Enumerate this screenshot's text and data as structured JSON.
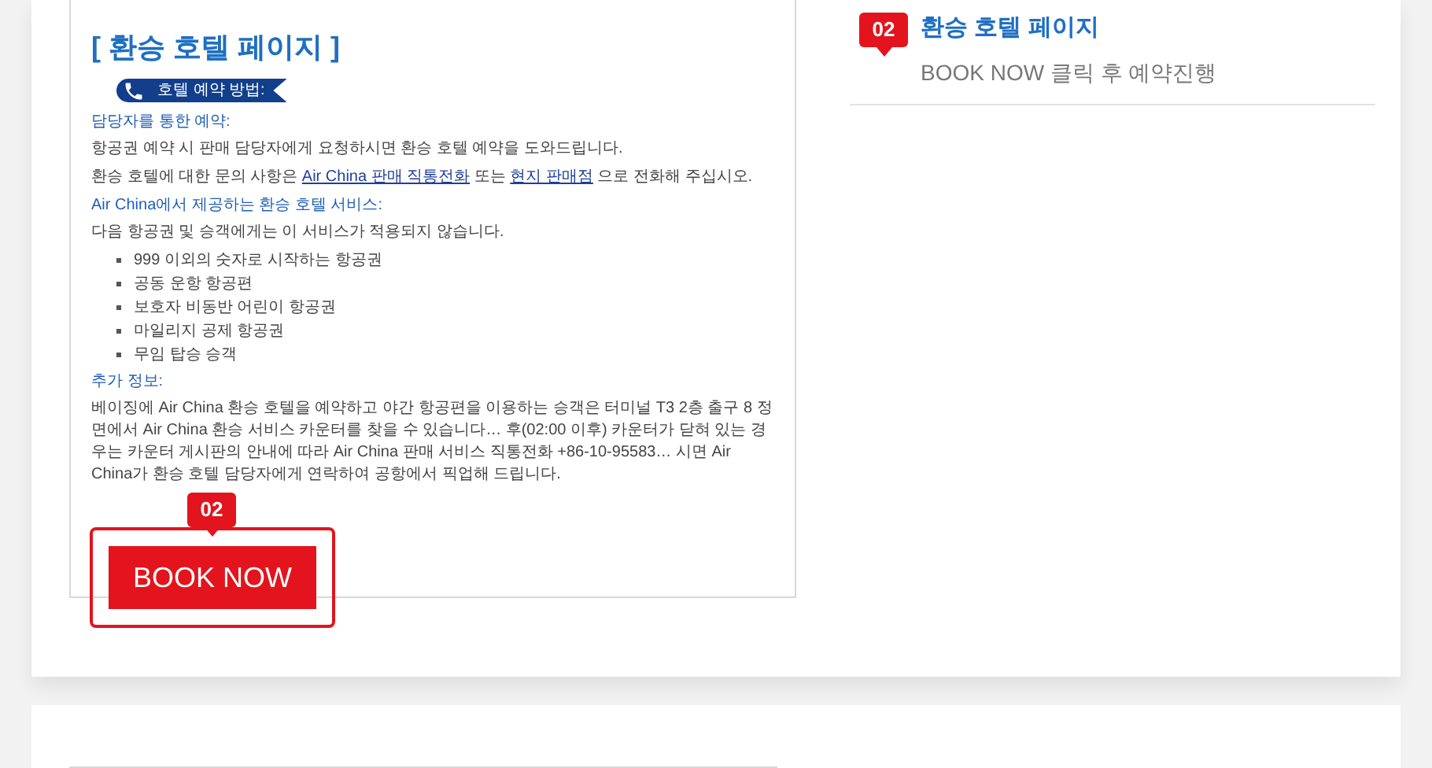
{
  "guide_card": {
    "heading": "[ 환승 호텔 페이지 ]",
    "ribbon": "호텔 예약 방법:",
    "blocks": [
      {
        "kind": "label",
        "text": "담당자를 통한 예약:"
      },
      {
        "kind": "paragraph",
        "parts": [
          {
            "text": "항공권 예약 시 판매 담당자에게 요청하시면 환승 호텔 예약을 도와드립니다.",
            "link": false
          }
        ]
      },
      {
        "kind": "paragraph",
        "parts": [
          {
            "text": "환승 호텔에 대한 문의 사항은 ",
            "link": false
          },
          {
            "text": "Air China 판매 직통전화",
            "link": true
          },
          {
            "text": " 또는 ",
            "link": false
          },
          {
            "text": "현지 판매점",
            "link": true
          },
          {
            "text": " 으로 전화해 주십시오.",
            "link": false
          }
        ]
      },
      {
        "kind": "label",
        "text": "Air China에서 제공하는 환승 호텔 서비스:"
      },
      {
        "kind": "paragraph",
        "parts": [
          {
            "text": "다음 항공권 및 승객에게는 이 서비스가 적용되지 않습니다.",
            "link": false
          }
        ]
      },
      {
        "kind": "bullets",
        "items": [
          "999 이외의 숫자로 시작하는 항공권",
          "공동 운항 항공편",
          "보호자 비동반 어린이 항공권",
          "마일리지 공제 항공권",
          "무임 탑승 승객"
        ]
      },
      {
        "kind": "label",
        "text": "추가 정보:"
      },
      {
        "kind": "paragraph",
        "parts": [
          {
            "text": "베이징에 Air China 환승 호텔을 예약하고 야간 항공편을 이용하는 승객은 터미널 T3 2층 출구 8 정면에서 Air China 환승 서비스 카운터를 찾을 수 있습니다… 후(02:00 이후) 카운터가 닫혀 있는 경우는 카운터 게시판의 안내에 따라 Air China 판매 서비스 직통전화 +86-10-95583… 시면 Air China가 환승 호텔 담당자에게 연락하여 공항에서 픽업해 드립니다.",
            "link": false
          }
        ]
      }
    ],
    "book_button": "BOOK NOW",
    "callout_badge": "02"
  },
  "step": {
    "badge": "02",
    "title": "환승 호텔 페이지",
    "description": "BOOK NOW 클릭 후 예약진행"
  }
}
